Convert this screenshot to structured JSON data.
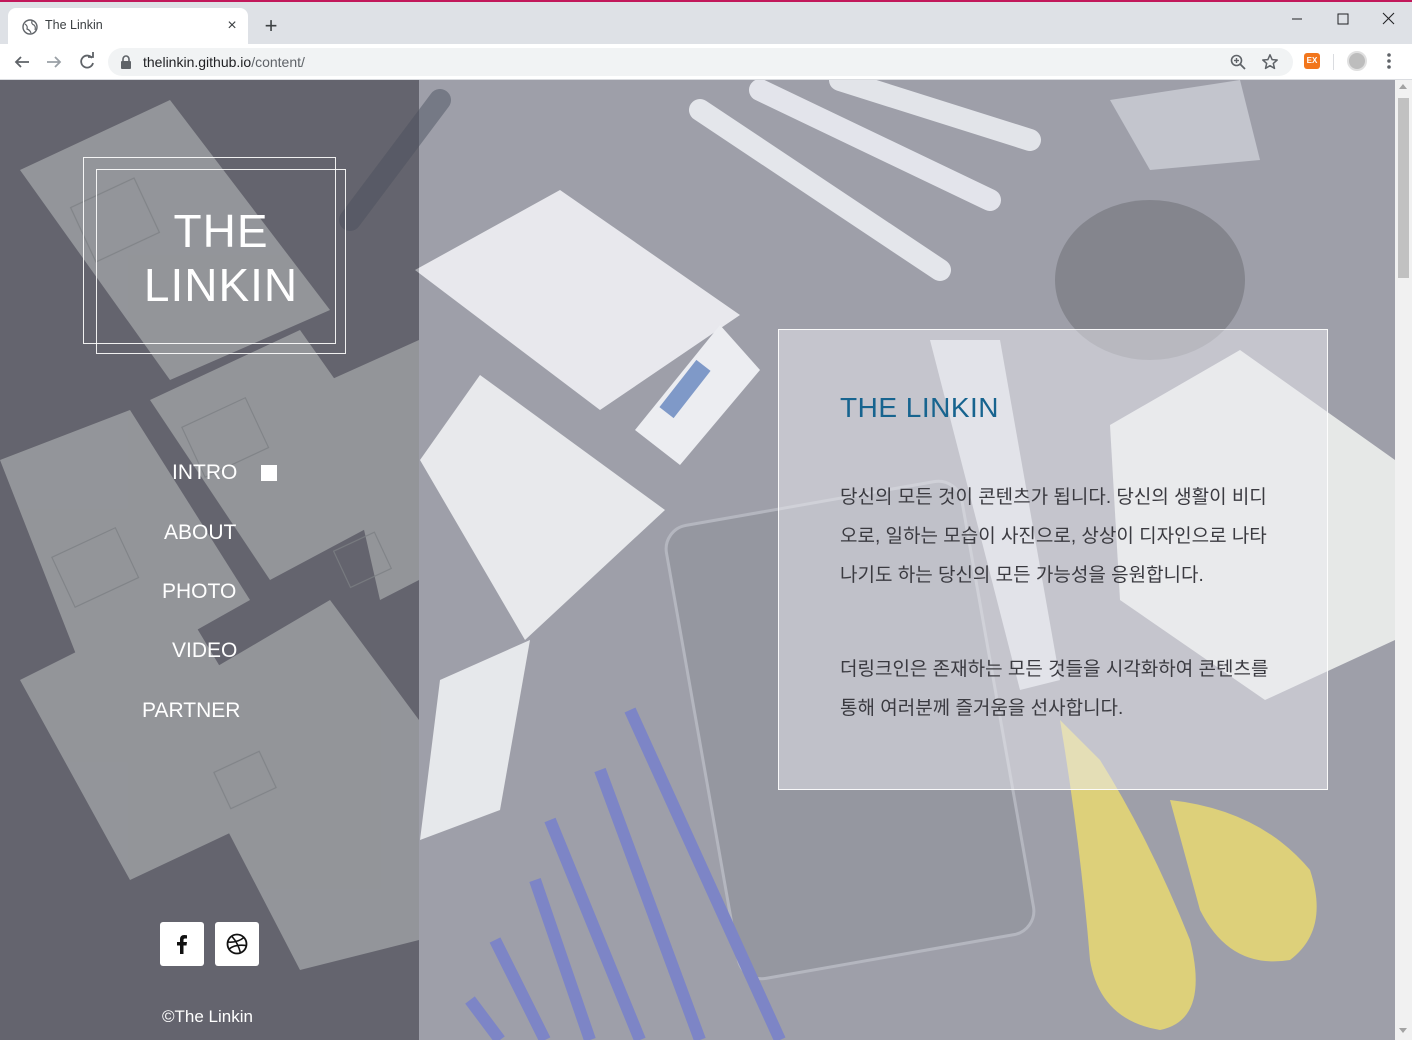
{
  "browser": {
    "tab_title": "The Linkin",
    "tab_close": "×",
    "new_tab": "+",
    "url_host": "thelinkin.github.io",
    "url_path": "/content/",
    "extension_label": "EX"
  },
  "site": {
    "logo_line1": "THE",
    "logo_line2": "LINKIN",
    "nav": [
      {
        "label": "INTRO",
        "active": true
      },
      {
        "label": "ABOUT"
      },
      {
        "label": "PHOTO"
      },
      {
        "label": "VIDEO"
      },
      {
        "label": "PARTNER"
      }
    ],
    "social": [
      {
        "icon": "facebook-icon"
      },
      {
        "icon": "dribbble-icon"
      }
    ],
    "copyright": "©The Linkin"
  },
  "content": {
    "title": "THE LINKIN",
    "paragraph1": "당신의 모든 것이 콘텐츠가 됩니다. 당신의 생활이 비디오로, 일하는 모습이 사진으로, 상상이 디자인으로 나타나기도 하는 당신의 모든 가능성을 응원합니다.",
    "paragraph2": "더링크인은 존재하는 모든 것들을 시각화하여 콘텐츠를 통해 여러분께 즐거움을 선사합니다."
  },
  "colors": {
    "accent_title": "#17648f",
    "sidebar_overlay": "rgba(110,110,118,0.55)",
    "scissors": "#e8d23a"
  }
}
